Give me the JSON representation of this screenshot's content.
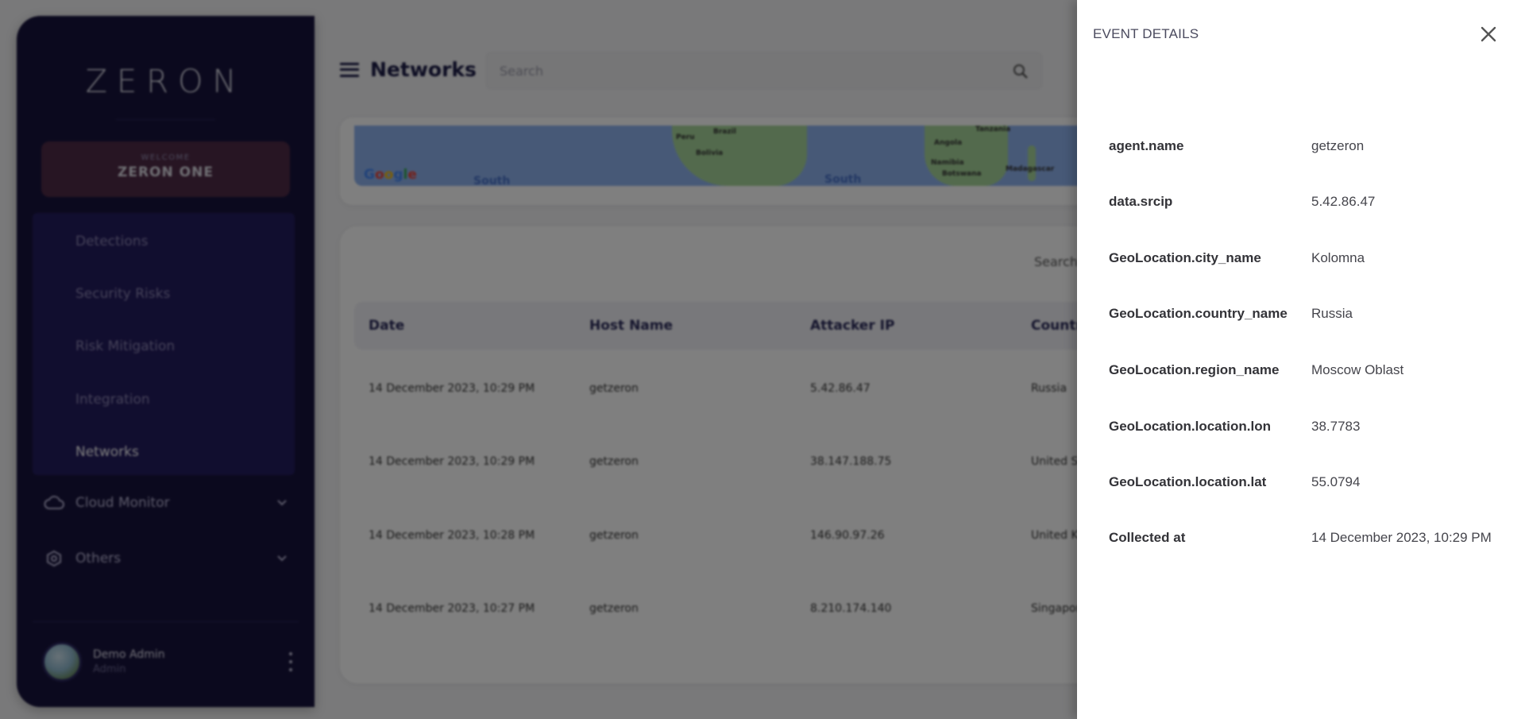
{
  "app": {
    "brand": "ZERON",
    "welcome_label": "WELCOME",
    "org_name": "ZERON ONE"
  },
  "sidebar": {
    "sub_items": [
      {
        "label": "Detections",
        "active": false
      },
      {
        "label": "Security Risks",
        "active": false
      },
      {
        "label": "Risk Mitigation",
        "active": false
      },
      {
        "label": "Integration",
        "active": false
      },
      {
        "label": "Networks",
        "active": true
      }
    ],
    "groups": [
      {
        "label": "Cloud Monitor",
        "icon": "cloud-icon"
      },
      {
        "label": "Others",
        "icon": "gear-icon"
      }
    ],
    "user": {
      "name": "Demo Admin",
      "role": "Admin"
    }
  },
  "header": {
    "title": "Networks",
    "search_placeholder": "Search"
  },
  "map": {
    "labels": [
      "Peru",
      "Brazil",
      "Bolivia",
      "Angola",
      "Namibia",
      "Botswana",
      "Madagascar",
      "Tanzania"
    ],
    "ocean_labels": [
      "South",
      "South"
    ],
    "attribution": "Google"
  },
  "table": {
    "search_label": "Search",
    "columns": [
      "Date",
      "Host Name",
      "Attacker IP",
      "Country"
    ],
    "rows": [
      {
        "date": "14 December 2023, 10:29 PM",
        "host": "getzeron",
        "ip": "5.42.86.47",
        "country": "Russia"
      },
      {
        "date": "14 December 2023, 10:29 PM",
        "host": "getzeron",
        "ip": "38.147.188.75",
        "country": "United States"
      },
      {
        "date": "14 December 2023, 10:28 PM",
        "host": "getzeron",
        "ip": "146.90.97.26",
        "country": "United Kingdom"
      },
      {
        "date": "14 December 2023, 10:27 PM",
        "host": "getzeron",
        "ip": "8.210.174.140",
        "country": "Singapore"
      }
    ]
  },
  "drawer": {
    "title": "EVENT DETAILS",
    "fields": [
      {
        "key": "agent.name",
        "value": "getzeron"
      },
      {
        "key": "data.srcip",
        "value": "5.42.86.47"
      },
      {
        "key": "GeoLocation.city_name",
        "value": "Kolomna"
      },
      {
        "key": "GeoLocation.country_name",
        "value": "Russia"
      },
      {
        "key": "GeoLocation.region_name",
        "value": "Moscow Oblast"
      },
      {
        "key": "GeoLocation.location.lon",
        "value": "38.7783"
      },
      {
        "key": "GeoLocation.location.lat",
        "value": "55.0794"
      },
      {
        "key": "Collected at",
        "value": "14 December 2023, 10:29 PM"
      }
    ]
  },
  "colors": {
    "sidebar_bg": "#17133c",
    "subnav_bg": "#231c5e",
    "welcome_bg": "#4e2a46",
    "title_text": "#1b1b46",
    "overlay": "rgba(0,0,0,0.5)"
  }
}
